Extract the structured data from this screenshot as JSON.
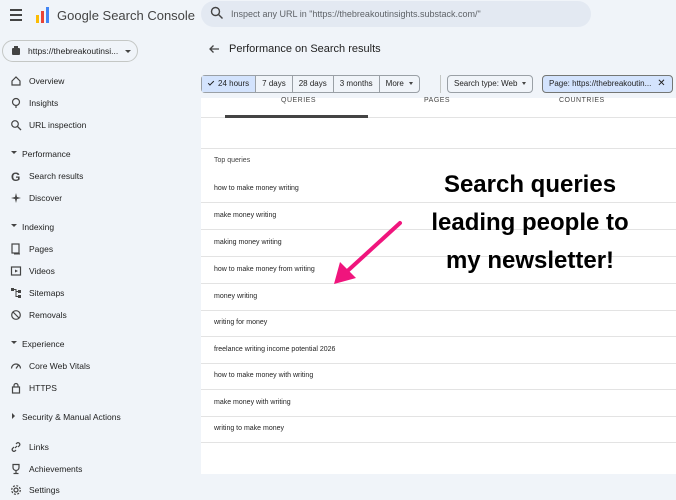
{
  "app": {
    "title": "Google Search Console"
  },
  "search": {
    "placeholder": "Inspect any URL in \"https://thebreakoutinsights.substack.com/\""
  },
  "property": {
    "label": "https://thebreakoutinsi..."
  },
  "sidebar": {
    "items": [
      {
        "label": "Overview",
        "icon": "home-icon"
      },
      {
        "label": "Insights",
        "icon": "insights-icon"
      },
      {
        "label": "URL inspection",
        "icon": "search-icon"
      }
    ],
    "sections": [
      {
        "label": "Performance",
        "items": [
          {
            "label": "Search results",
            "icon": "google-g-icon"
          },
          {
            "label": "Discover",
            "icon": "discover-icon"
          }
        ]
      },
      {
        "label": "Indexing",
        "items": [
          {
            "label": "Pages",
            "icon": "pages-icon"
          },
          {
            "label": "Videos",
            "icon": "videos-icon"
          },
          {
            "label": "Sitemaps",
            "icon": "sitemaps-icon"
          },
          {
            "label": "Removals",
            "icon": "removals-icon"
          }
        ]
      },
      {
        "label": "Experience",
        "items": [
          {
            "label": "Core Web Vitals",
            "icon": "gauge-icon"
          },
          {
            "label": "HTTPS",
            "icon": "lock-icon"
          }
        ]
      },
      {
        "label": "Security & Manual Actions",
        "collapsed": true
      },
      {
        "label": "",
        "items": [
          {
            "label": "Links",
            "icon": "links-icon"
          },
          {
            "label": "Achievements",
            "icon": "trophy-icon"
          },
          {
            "label": "Settings",
            "icon": "settings-icon"
          }
        ]
      }
    ]
  },
  "header": {
    "title": "Performance on Search results"
  },
  "filters": {
    "date_range": [
      "24 hours",
      "7 days",
      "28 days",
      "3 months",
      "More"
    ],
    "selected_date": "24 hours",
    "search_type": "Search type: Web",
    "page": "Page: https://thebreakoutin..."
  },
  "tabs": [
    "QUERIES",
    "PAGES",
    "COUNTRIES"
  ],
  "table": {
    "header": "Top queries",
    "rows": [
      "how to make money writing",
      "make money writing",
      "making money writing",
      "how to make money from writing",
      "money writing",
      "writing for money",
      "freelance writing income potential 2026",
      "how to make money with writing",
      "make money with writing",
      "writing to make money"
    ]
  },
  "annotation": {
    "lines": [
      "Search queries",
      "leading people to",
      "my newsletter!"
    ],
    "color": "#000000",
    "arrow_color": "#f0157d"
  },
  "colors": {
    "background": "#f0f4f9",
    "selected_chip": "#d3e3fd",
    "card": "#ffffff"
  }
}
